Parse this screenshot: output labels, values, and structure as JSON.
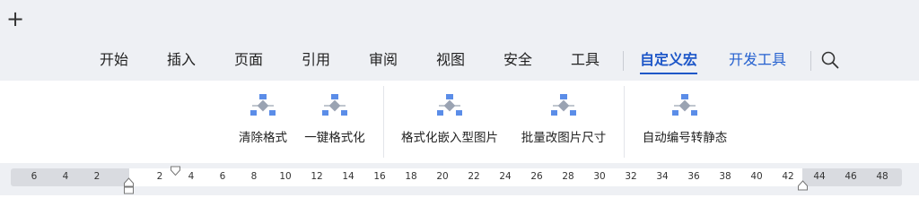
{
  "titlebar": {
    "new_tab_symbol": "+"
  },
  "menu_tabs": [
    {
      "label": "开始"
    },
    {
      "label": "插入"
    },
    {
      "label": "页面"
    },
    {
      "label": "引用"
    },
    {
      "label": "审阅"
    },
    {
      "label": "视图"
    },
    {
      "label": "安全"
    },
    {
      "label": "工具"
    },
    {
      "label": "自定义宏",
      "state": "active"
    },
    {
      "label": "开发工具"
    }
  ],
  "search_icon": "search-icon",
  "ribbon_buttons": [
    {
      "label": "清除格式",
      "icon": "flowchart-icon"
    },
    {
      "label": "一键格式化",
      "icon": "flowchart-icon"
    },
    {
      "label": "格式化嵌入型图片",
      "icon": "flowchart-icon"
    },
    {
      "label": "批量改图片尺寸",
      "icon": "flowchart-icon"
    },
    {
      "label": "自动编号转静态",
      "icon": "flowchart-icon"
    }
  ],
  "ruler": {
    "ticks": [
      "6",
      "4",
      "2",
      "2",
      "4",
      "6",
      "8",
      "10",
      "12",
      "14",
      "16",
      "18",
      "20",
      "22",
      "24",
      "26",
      "28",
      "30",
      "32",
      "34",
      "36",
      "38",
      "40",
      "42",
      "44",
      "46",
      "48"
    ]
  },
  "colors": {
    "accent": "#1e57c8",
    "icon_blue": "#5b8de8",
    "icon_gray": "#9aa3b2"
  }
}
